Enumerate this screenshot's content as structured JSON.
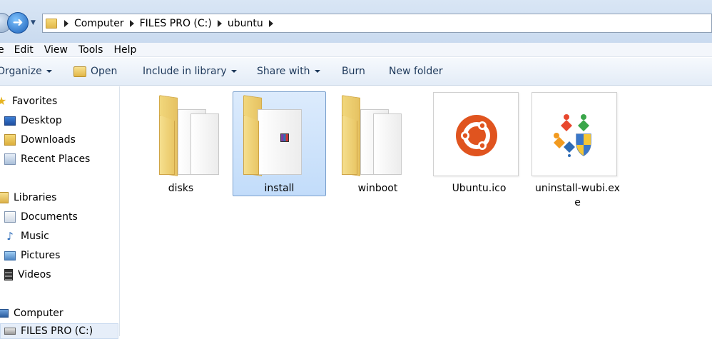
{
  "address": {
    "crumbs": [
      "Computer",
      "FILES PRO (C:)",
      "ubuntu"
    ]
  },
  "menu": {
    "items": [
      "e",
      "Edit",
      "View",
      "Tools",
      "Help"
    ]
  },
  "toolbar": {
    "organize": "Organize",
    "open": "Open",
    "include": "Include in library",
    "share": "Share with",
    "burn": "Burn",
    "new_folder": "New folder"
  },
  "nav": {
    "favorites": "Favorites",
    "desktop": "Desktop",
    "downloads": "Downloads",
    "recent": "Recent Places",
    "libraries": "Libraries",
    "documents": "Documents",
    "music": "Music",
    "pictures": "Pictures",
    "videos": "Videos",
    "computer": "Computer",
    "drive": "FILES PRO (C:)"
  },
  "files": {
    "disks": "disks",
    "install": "install",
    "winboot": "winboot",
    "ubuntu_ico": "Ubuntu.ico",
    "uninstall": "uninstall-wubi.exe"
  },
  "colors": {
    "selection": "#cce1fb",
    "ubuntu_orange": "#e0541f"
  }
}
